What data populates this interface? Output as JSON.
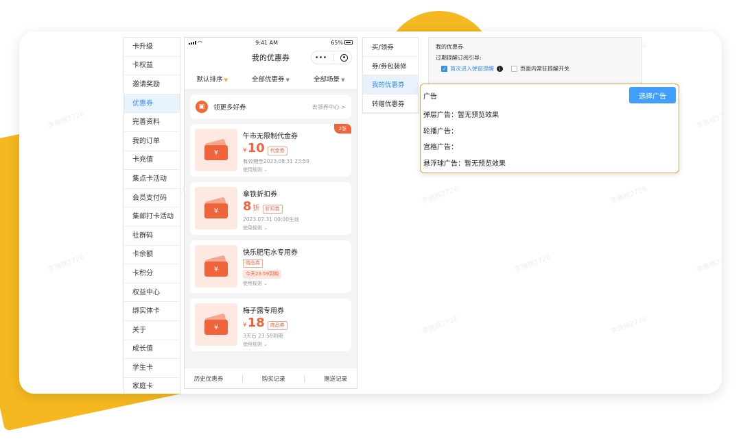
{
  "watermark": "李雅楠2726",
  "menu": {
    "items": [
      {
        "label": "卡升级",
        "active": false
      },
      {
        "label": "卡权益",
        "active": false
      },
      {
        "label": "邀请奖励",
        "active": false
      },
      {
        "label": "优惠券",
        "active": true
      },
      {
        "label": "完善资料",
        "active": false
      },
      {
        "label": "我的订单",
        "active": false
      },
      {
        "label": "卡充值",
        "active": false
      },
      {
        "label": "集点卡活动",
        "active": false
      },
      {
        "label": "会员支付码",
        "active": false
      },
      {
        "label": "集邮打卡活动",
        "active": false
      },
      {
        "label": "社群码",
        "active": false
      },
      {
        "label": "卡余额",
        "active": false
      },
      {
        "label": "卡积分",
        "active": false
      },
      {
        "label": "权益中心",
        "active": false
      },
      {
        "label": "绑实体卡",
        "active": false
      },
      {
        "label": "关于",
        "active": false
      },
      {
        "label": "成长值",
        "active": false
      },
      {
        "label": "学生卡",
        "active": false
      },
      {
        "label": "家庭卡",
        "active": false
      }
    ]
  },
  "phone": {
    "status": {
      "time": "9:41 AM",
      "battery": "65%"
    },
    "title": "我的优惠券",
    "capsule_more": "•••",
    "filters": [
      "默认排序",
      "全部优惠券",
      "全部场景"
    ],
    "promo": {
      "text": "领更多好券",
      "link": "去领券中心 >"
    },
    "coupons": [
      {
        "title": "午市无限制代金券",
        "yen": "¥",
        "value": "10",
        "unit": "",
        "tag": "代金券",
        "date": "有效期至2023.08.31 23:59",
        "rule": "使用规则 ⌄",
        "badge": "2张"
      },
      {
        "title": "拿铁折扣券",
        "yen": "",
        "value": "8",
        "unit": "折",
        "tag": "折扣券",
        "date": "2023.07.31 00:00生效",
        "rule": "使用规则 ⌄",
        "badge": ""
      },
      {
        "title": "快乐肥宅水专用券",
        "yen": "",
        "value": "",
        "unit": "",
        "tag": "赠品券",
        "date": "今天23:59到期",
        "rule": "使用规则 ⌄",
        "badge": ""
      },
      {
        "title": "梅子露专用券",
        "yen": "¥",
        "value": "18",
        "unit": "",
        "tag": "商品券",
        "date": "3天后 23:59到期",
        "rule": "使用规则 ⌄",
        "badge": ""
      }
    ],
    "bottom_tabs": [
      "历史优惠券",
      "购买记录",
      "赠送记录"
    ]
  },
  "menu2": {
    "items": [
      {
        "label": "买/领券",
        "active": false
      },
      {
        "label": "券/券包装修",
        "active": false
      },
      {
        "label": "我的优惠券",
        "active": true
      },
      {
        "label": "转赠优惠券",
        "active": false
      }
    ]
  },
  "settings": {
    "title": "我的优惠券",
    "subtitle": "过期提醒订阅引导:",
    "option1": "首次进入弹窗提醒",
    "option2": "页面内常驻提醒开关"
  },
  "ad": {
    "title": "广告",
    "button": "选择广告",
    "rows": [
      "弹层广告：暂无预览效果",
      "轮播广告：",
      "宫格广告：",
      "悬浮球广告：暂无预览效果"
    ]
  }
}
